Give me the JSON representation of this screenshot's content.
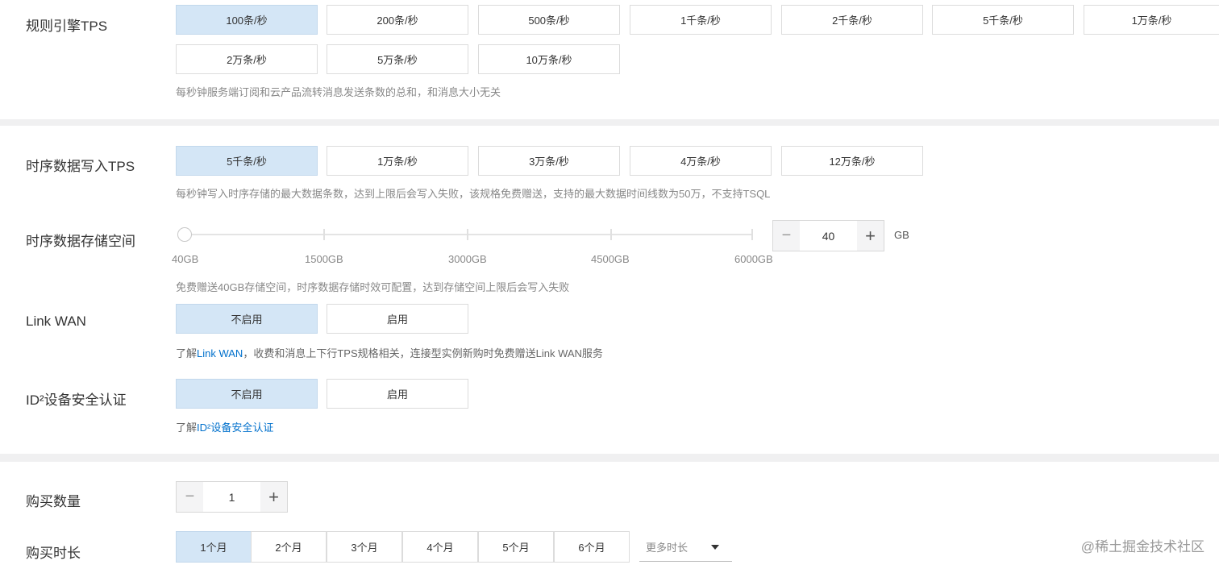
{
  "rule_engine": {
    "label": "规则引擎TPS",
    "options": [
      "100条/秒",
      "200条/秒",
      "500条/秒",
      "1千条/秒",
      "2千条/秒",
      "5千条/秒",
      "1万条/秒",
      "2万条/秒",
      "5万条/秒",
      "10万条/秒"
    ],
    "selected": "100条/秒",
    "hint": "每秒钟服务端订阅和云产品流转消息发送条数的总和，和消息大小无关"
  },
  "ts_write": {
    "label": "时序数据写入TPS",
    "options": [
      "5千条/秒",
      "1万条/秒",
      "3万条/秒",
      "4万条/秒",
      "12万条/秒"
    ],
    "selected": "5千条/秒",
    "hint": "每秒钟写入时序存储的最大数据条数，达到上限后会写入失败，该规格免费赠送，支持的最大数据时间线数为50万，不支持TSQL"
  },
  "ts_storage": {
    "label": "时序数据存储空间",
    "ticks": [
      "40GB",
      "1500GB",
      "3000GB",
      "4500GB",
      "6000GB"
    ],
    "value": "40",
    "unit": "GB",
    "slider_position": 0,
    "hint": "免费赠送40GB存储空间，时序数据存储时效可配置，达到存储空间上限后会写入失败"
  },
  "link_wan": {
    "label": "Link WAN",
    "options": [
      "不启用",
      "启用"
    ],
    "selected": "不启用",
    "hint_prefix": "了解",
    "hint_link": "Link WAN",
    "hint_suffix": "，收费和消息上下行TPS规格相关，连接型实例新购时免费赠送Link WAN服务"
  },
  "id2": {
    "label": "ID²设备安全认证",
    "options": [
      "不启用",
      "启用"
    ],
    "selected": "不启用",
    "hint_prefix": "了解",
    "hint_link": "ID²设备安全认证"
  },
  "quantity": {
    "label": "购买数量",
    "value": "1",
    "minus": "−",
    "plus": "+"
  },
  "duration": {
    "label": "购买时长",
    "options": [
      "1个月",
      "2个月",
      "3个月",
      "4个月",
      "5个月",
      "6个月"
    ],
    "selected": "1个月",
    "more": "更多时长"
  },
  "watermark": "@稀土掘金技术社区",
  "colors": {
    "selected_bg": "#d4e6f6",
    "link": "#0070cc",
    "section_divider": "#f0f0f1"
  }
}
